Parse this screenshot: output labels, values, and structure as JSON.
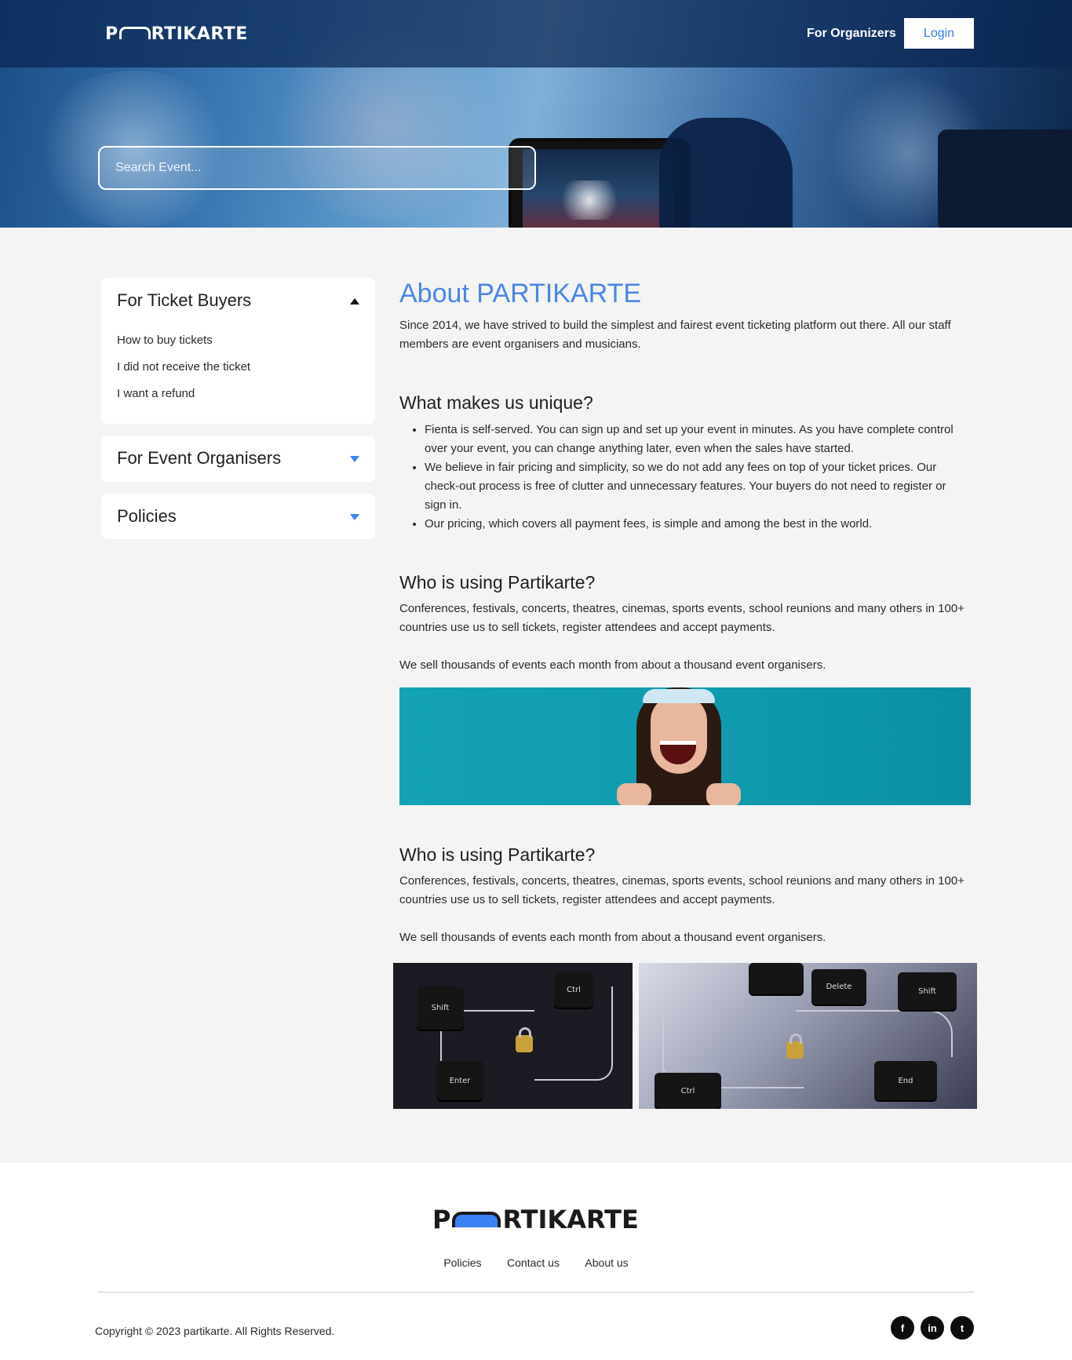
{
  "header": {
    "logo_left": "P",
    "logo_right": "RTIKARTE",
    "nav_link": "For Organizers",
    "login_label": "Login"
  },
  "search": {
    "placeholder": "Search Event..."
  },
  "sidebar": {
    "sections": [
      {
        "title": "For Ticket Buyers",
        "expanded": true,
        "links": [
          "How to buy tickets",
          "I did not receive the ticket",
          "I want a refund"
        ]
      },
      {
        "title": "For Event Organisers",
        "expanded": false
      },
      {
        "title": "Policies",
        "expanded": false
      }
    ]
  },
  "main": {
    "title": "About PARTIKARTE",
    "intro": "Since 2014, we have strived to build the simplest and fairest event ticketing platform out there. All our staff members are event organisers and musicians.",
    "unique_heading": "What makes us unique?",
    "unique_points": [
      "Fienta is self-served. You can sign up and set up your event in minutes. As you have complete control over your event, you can change anything later, even when the sales have started.",
      "We believe in fair pricing and simplicity, so we do not add any fees on top of your ticket prices. Our check-out process is free of clutter and unnecessary features. Your buyers do not need to register or sign in.",
      "Our pricing, which covers all payment fees, is simple and among the best in the world."
    ],
    "using_heading_1": "Who is using Partikarte?",
    "using_text_1": "Conferences, festivals, concerts, theatres, cinemas, sports events, school reunions and many others in 100+ countries use us to sell tickets, register attendees and accept payments.",
    "using_text_1b": "We sell thousands of events each month from about a thousand event organisers.",
    "using_heading_2": "Who is using Partikarte?",
    "using_text_2": "Conferences, festivals, concerts, theatres, cinemas, sports events, school reunions and many others in 100+ countries use us to sell tickets, register attendees and accept payments.",
    "using_text_2b": "We sell thousands of events each month from about a thousand event organisers."
  },
  "keys": {
    "shift": "Shift",
    "ctrl": "Ctrl",
    "enter": "Enter",
    "delete": "Delete",
    "end": "End"
  },
  "footer": {
    "logo_left": "P",
    "logo_right": "RTIKARTE",
    "links": [
      "Policies",
      "Contact us",
      "About us"
    ],
    "copyright": "Copyright © 2023 partikarte. All Rights Reserved.",
    "social": [
      "f",
      "in",
      "t"
    ]
  },
  "colors": {
    "accent": "#4a86e8",
    "caret_blue": "#3b82f6",
    "page_bg": "#f4f4f4"
  }
}
